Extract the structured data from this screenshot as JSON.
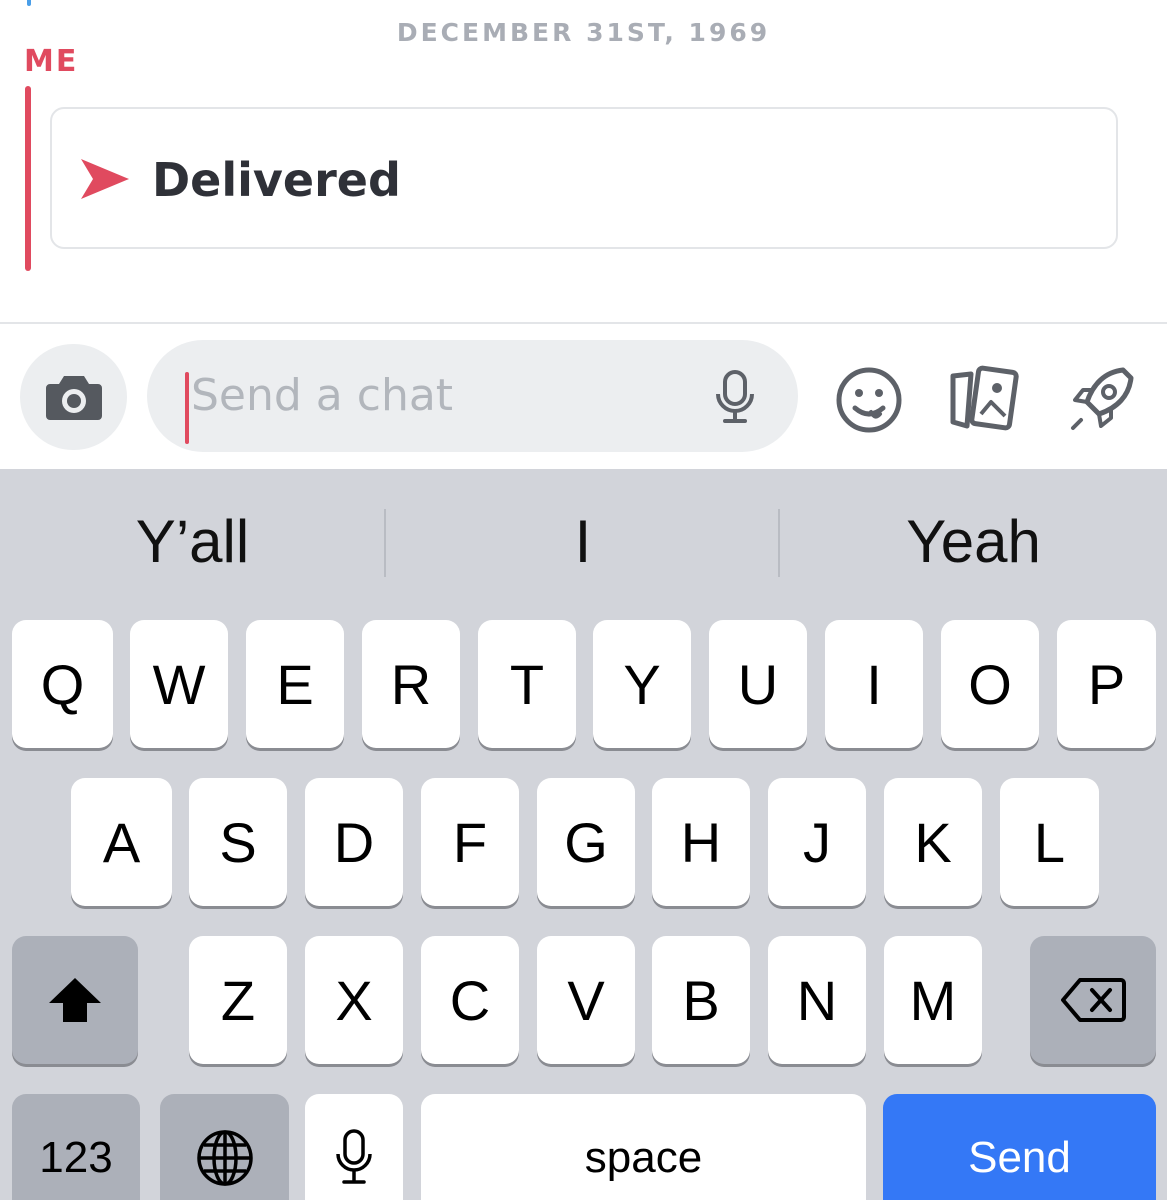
{
  "chat": {
    "date_header": "DECEMBER 31ST, 1969",
    "sender_label": "ME",
    "message_status": "Delivered",
    "accent_color": "#e04a5f"
  },
  "composer": {
    "placeholder": "Send a chat",
    "icons": [
      "camera-icon",
      "microphone-icon",
      "emoji-icon",
      "stickers-icon",
      "rocket-icon"
    ]
  },
  "keyboard": {
    "suggestions": [
      "Y’all",
      "I",
      "Yeah"
    ],
    "row1": [
      "Q",
      "W",
      "E",
      "R",
      "T",
      "Y",
      "U",
      "I",
      "O",
      "P"
    ],
    "row2": [
      "A",
      "S",
      "D",
      "F",
      "G",
      "H",
      "J",
      "K",
      "L"
    ],
    "row3": [
      "Z",
      "X",
      "C",
      "V",
      "B",
      "N",
      "M"
    ],
    "numbers_label": "123",
    "space_label": "space",
    "send_label": "Send",
    "send_color": "#3478f6"
  }
}
